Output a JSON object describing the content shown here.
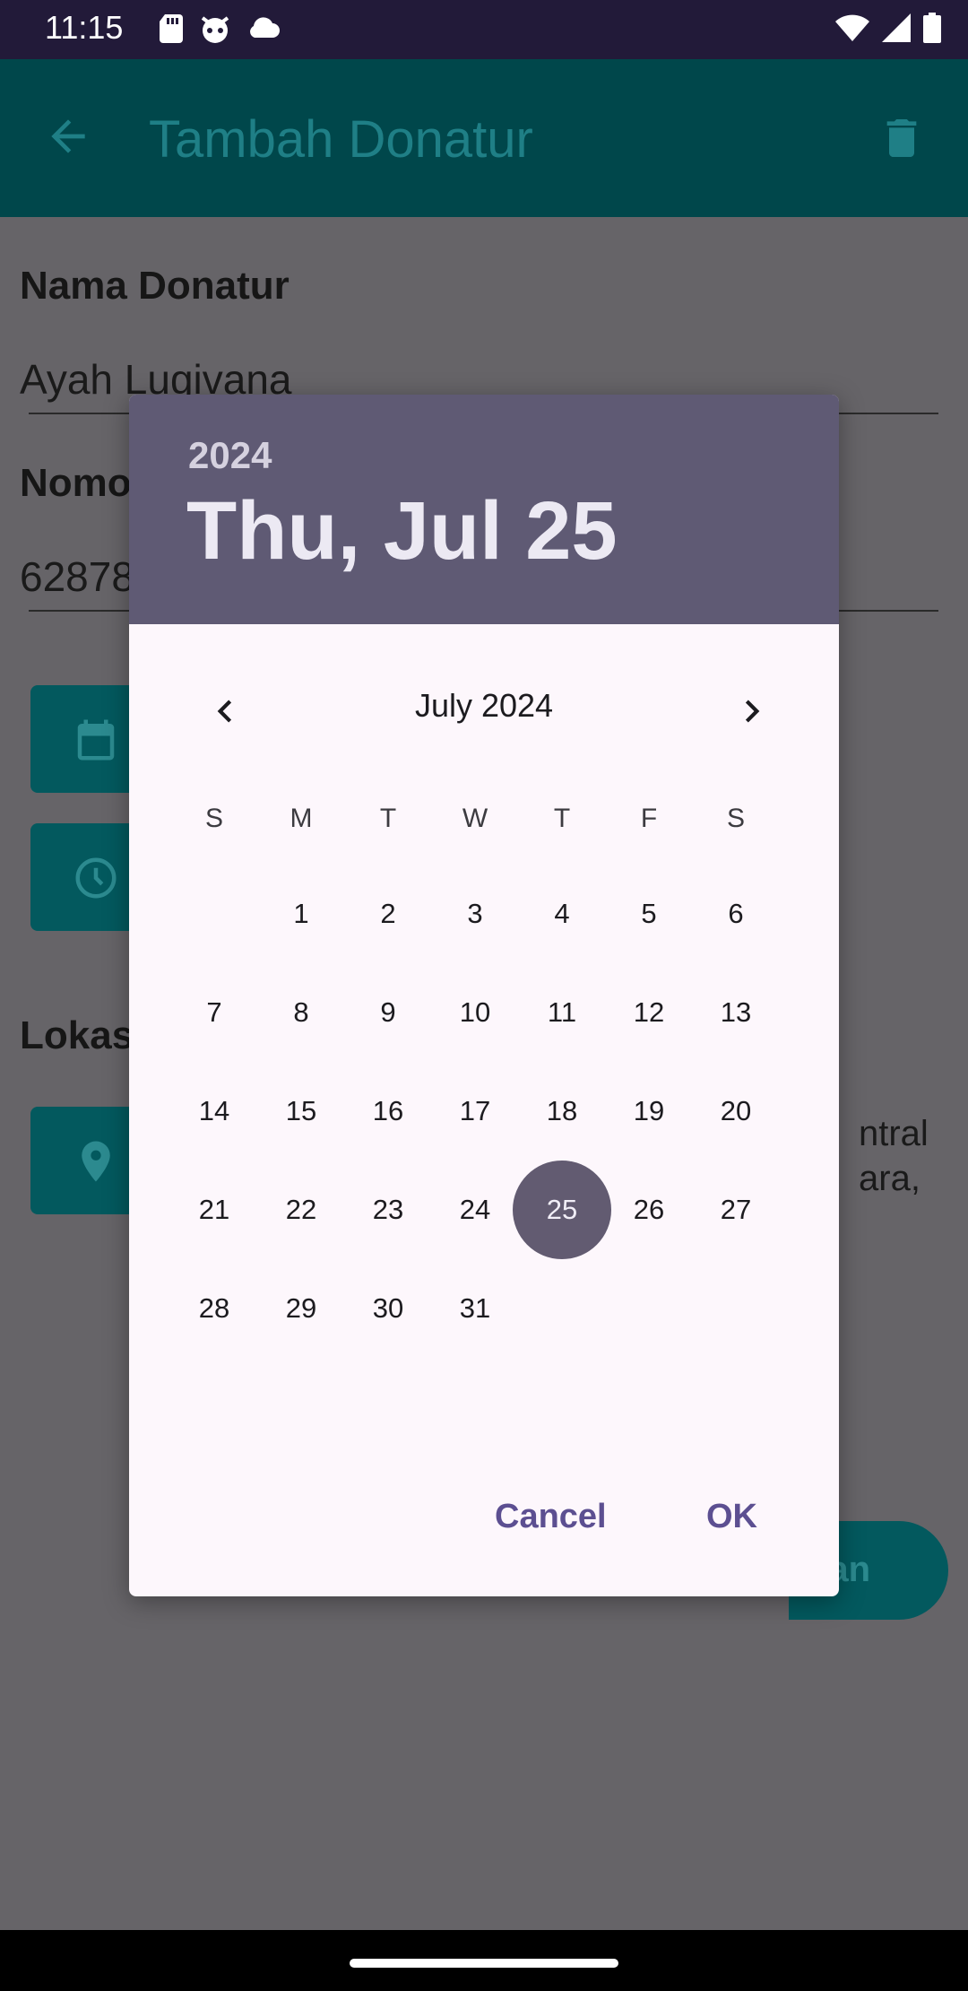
{
  "status": {
    "time": "11:15"
  },
  "appbar": {
    "title": "Tambah Donatur"
  },
  "form": {
    "name_label": "Nama Donatur",
    "name_value": "Ayah Lugivana",
    "phone_label": "Nomo",
    "phone_value": "62878",
    "location_label": "Lokas",
    "location_side_1": "ntral",
    "location_side_2": "ara,",
    "save_partial": "pan"
  },
  "datepicker": {
    "year": "2024",
    "selected_date": "Thu, Jul 25",
    "month_label": "July 2024",
    "weekdays": [
      "S",
      "M",
      "T",
      "W",
      "T",
      "F",
      "S"
    ],
    "days": [
      "1",
      "2",
      "3",
      "4",
      "5",
      "6",
      "7",
      "8",
      "9",
      "10",
      "11",
      "12",
      "13",
      "14",
      "15",
      "16",
      "17",
      "18",
      "19",
      "20",
      "21",
      "22",
      "23",
      "24",
      "25",
      "26",
      "27",
      "28",
      "29",
      "30",
      "31"
    ],
    "selected_day": "25",
    "cancel_label": "Cancel",
    "ok_label": "OK"
  },
  "icons": {
    "status": [
      "sd-card-icon",
      "cat-icon",
      "cloud-icon",
      "wifi-icon",
      "signal-icon",
      "battery-icon"
    ],
    "appbar": [
      "back-arrow-icon",
      "trash-icon"
    ],
    "form": [
      "calendar-icon",
      "clock-icon",
      "location-pin-icon"
    ],
    "picker": [
      "chevron-left-icon",
      "chevron-right-icon"
    ]
  },
  "colors": {
    "header": "#5f5a74",
    "selected_day": "#625b71",
    "action_text": "#5c4f91",
    "appbar": "#00474b"
  }
}
